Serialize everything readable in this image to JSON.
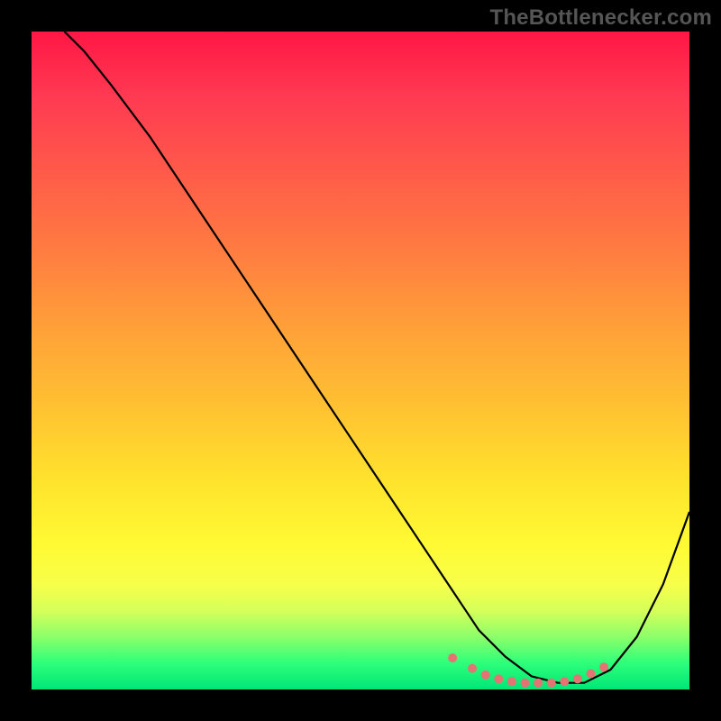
{
  "watermark": "TheBottlenecker.com",
  "chart_data": {
    "type": "line",
    "title": "",
    "xlabel": "",
    "ylabel": "",
    "xlim": [
      0,
      100
    ],
    "ylim": [
      0,
      100
    ],
    "grid": false,
    "legend": false,
    "background_gradient": [
      "#ff1744",
      "#ff7e40",
      "#ffe22d",
      "#00e676"
    ],
    "series": [
      {
        "name": "bottleneck-curve",
        "color": "#000000",
        "x": [
          5,
          8,
          12,
          18,
          24,
          30,
          36,
          42,
          48,
          54,
          60,
          64,
          68,
          72,
          76,
          80,
          84,
          88,
          92,
          96,
          100
        ],
        "y": [
          100,
          97,
          92,
          84,
          75,
          66,
          57,
          48,
          39,
          30,
          21,
          15,
          9,
          5,
          2,
          1,
          1,
          3,
          8,
          16,
          27
        ]
      }
    ],
    "markers": {
      "name": "optimal-range-dots",
      "color": "#e57373",
      "x": [
        64,
        67,
        69,
        71,
        73,
        75,
        77,
        79,
        81,
        83,
        85,
        87
      ],
      "y": [
        4.8,
        3.2,
        2.2,
        1.6,
        1.2,
        1.0,
        1.0,
        1.0,
        1.2,
        1.6,
        2.4,
        3.4
      ]
    }
  }
}
